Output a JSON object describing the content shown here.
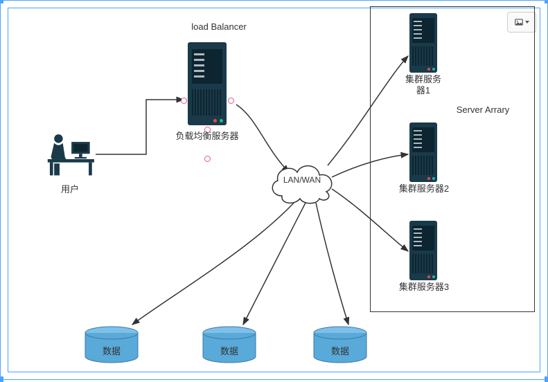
{
  "diagram": {
    "titleTop": "load Balancer",
    "userLabel": "用户",
    "loadBalancerLabel": "负载均衡服务器",
    "cloudLabel": "LAN/WAN",
    "serverArrayTitle": "Server Arrary",
    "clusterServer1": "集群服务器1",
    "clusterServer2": "集群服务器2",
    "clusterServer3": "集群服务器3",
    "dbLabel1": "数据",
    "dbLabel2": "数据",
    "dbLabel3": "数据"
  },
  "colors": {
    "server": "#1a3a4a",
    "db": "#59a9d9",
    "selection": "#4aa3ff",
    "arrow": "#333"
  }
}
